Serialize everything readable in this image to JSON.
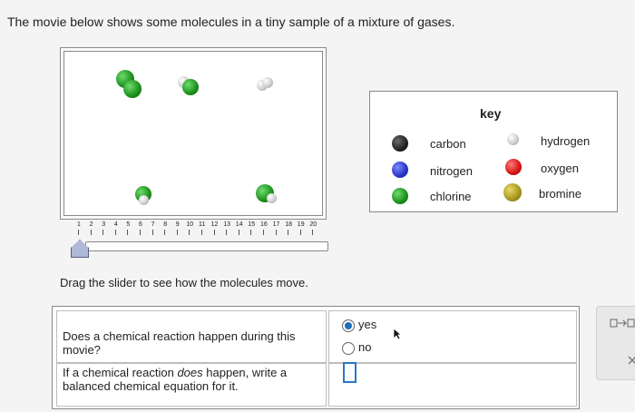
{
  "prompt": "The movie below shows some molecules in a tiny sample of a mixture of gases.",
  "slider": {
    "ticks": [
      "1",
      "2",
      "3",
      "4",
      "5",
      "6",
      "7",
      "8",
      "9",
      "10",
      "11",
      "12",
      "13",
      "14",
      "15",
      "16",
      "17",
      "18",
      "19",
      "20"
    ],
    "position": 1
  },
  "drag_hint": "Drag the slider to see how the molecules move.",
  "key": {
    "title": "key",
    "items": [
      {
        "label": "carbon",
        "color": "#222222"
      },
      {
        "label": "nitrogen",
        "color": "#2833c7"
      },
      {
        "label": "chlorine",
        "color": "#1a8f1a"
      },
      {
        "label": "hydrogen",
        "color": "#c9c9c9"
      },
      {
        "label": "oxygen",
        "color": "#d41414"
      },
      {
        "label": "bromine",
        "color": "#a5951c"
      }
    ]
  },
  "question1": {
    "text": "Does a chemical reaction happen during this movie?",
    "options": [
      "yes",
      "no"
    ],
    "selected": "yes"
  },
  "question2": {
    "text_before": "If a chemical reaction ",
    "text_emphasis": "does",
    "text_after": " happen, write a balanced chemical equation for it.",
    "value": ""
  },
  "side_panel": {
    "icon1": "reaction-arrow-icon",
    "icon2": "close-icon"
  }
}
